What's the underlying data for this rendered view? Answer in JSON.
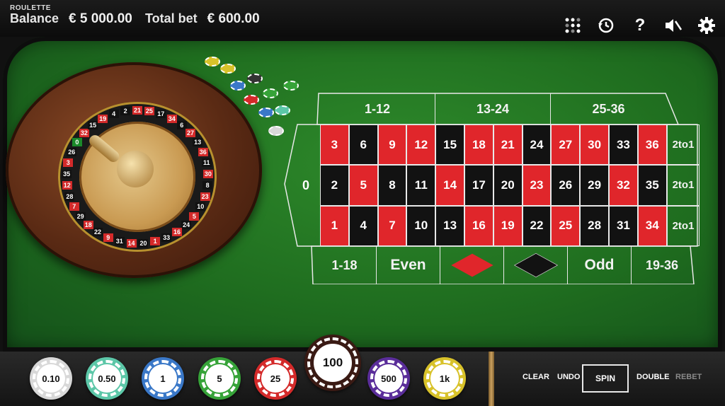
{
  "header": {
    "game_title": "ROULETTE",
    "balance_label": "Balance",
    "balance_value": "€ 5 000.00",
    "total_bet_label": "Total bet",
    "total_bet_value": "€ 600.00"
  },
  "toolbar_icons": [
    "grid-dots-icon",
    "history-icon",
    "help-icon",
    "sound-muted-icon",
    "settings-gear-icon"
  ],
  "colors": {
    "felt": "#2e8a2b",
    "red": "#e0262b",
    "black": "#121212",
    "line": "#e8e8e8"
  },
  "wheel": {
    "visible_numbers": [
      "21",
      "25",
      "17",
      "34",
      "6",
      "27",
      "13",
      "36",
      "11",
      "30",
      "8",
      "23",
      "10",
      "5",
      "24",
      "16",
      "33",
      "1",
      "20",
      "14",
      "31",
      "9",
      "22",
      "18",
      "29",
      "7",
      "28",
      "12",
      "35",
      "3",
      "26",
      "0",
      "32",
      "15",
      "19",
      "4",
      "2"
    ]
  },
  "table": {
    "zero": "0",
    "dozens": [
      "1-12",
      "13-24",
      "25-36"
    ],
    "rows": [
      [
        {
          "n": "3",
          "c": "red"
        },
        {
          "n": "6",
          "c": "black"
        },
        {
          "n": "9",
          "c": "red"
        },
        {
          "n": "12",
          "c": "red"
        },
        {
          "n": "15",
          "c": "black"
        },
        {
          "n": "18",
          "c": "red"
        },
        {
          "n": "21",
          "c": "red"
        },
        {
          "n": "24",
          "c": "black"
        },
        {
          "n": "27",
          "c": "red"
        },
        {
          "n": "30",
          "c": "red"
        },
        {
          "n": "33",
          "c": "black"
        },
        {
          "n": "36",
          "c": "red"
        }
      ],
      [
        {
          "n": "2",
          "c": "black"
        },
        {
          "n": "5",
          "c": "red"
        },
        {
          "n": "8",
          "c": "black"
        },
        {
          "n": "11",
          "c": "black"
        },
        {
          "n": "14",
          "c": "red"
        },
        {
          "n": "17",
          "c": "black"
        },
        {
          "n": "20",
          "c": "black"
        },
        {
          "n": "23",
          "c": "red"
        },
        {
          "n": "26",
          "c": "black"
        },
        {
          "n": "29",
          "c": "black"
        },
        {
          "n": "32",
          "c": "red"
        },
        {
          "n": "35",
          "c": "black"
        }
      ],
      [
        {
          "n": "1",
          "c": "red"
        },
        {
          "n": "4",
          "c": "black"
        },
        {
          "n": "7",
          "c": "red"
        },
        {
          "n": "10",
          "c": "black"
        },
        {
          "n": "13",
          "c": "black"
        },
        {
          "n": "16",
          "c": "red"
        },
        {
          "n": "19",
          "c": "red"
        },
        {
          "n": "22",
          "c": "black"
        },
        {
          "n": "25",
          "c": "red"
        },
        {
          "n": "28",
          "c": "black"
        },
        {
          "n": "31",
          "c": "black"
        },
        {
          "n": "34",
          "c": "red"
        }
      ]
    ],
    "columns": [
      "2to1",
      "2to1",
      "2to1"
    ],
    "outside": [
      "1-18",
      "Even",
      "red-diamond",
      "black-diamond",
      "Odd",
      "19-36"
    ]
  },
  "chips": [
    {
      "label": "0.10",
      "color": "#d8d8d8"
    },
    {
      "label": "0.50",
      "color": "#5cc7a8"
    },
    {
      "label": "1",
      "color": "#3a78c8"
    },
    {
      "label": "5",
      "color": "#36a338"
    },
    {
      "label": "25",
      "color": "#d42a2a"
    },
    {
      "label": "100",
      "color": "#3a1a14"
    },
    {
      "label": "500",
      "color": "#5a2d9a"
    },
    {
      "label": "1k",
      "color": "#d8c22a"
    }
  ],
  "controls": {
    "clear": "CLEAR",
    "undo": "UNDO",
    "spin": "SPIN",
    "double": "DOUBLE",
    "rebet": "REBET"
  }
}
